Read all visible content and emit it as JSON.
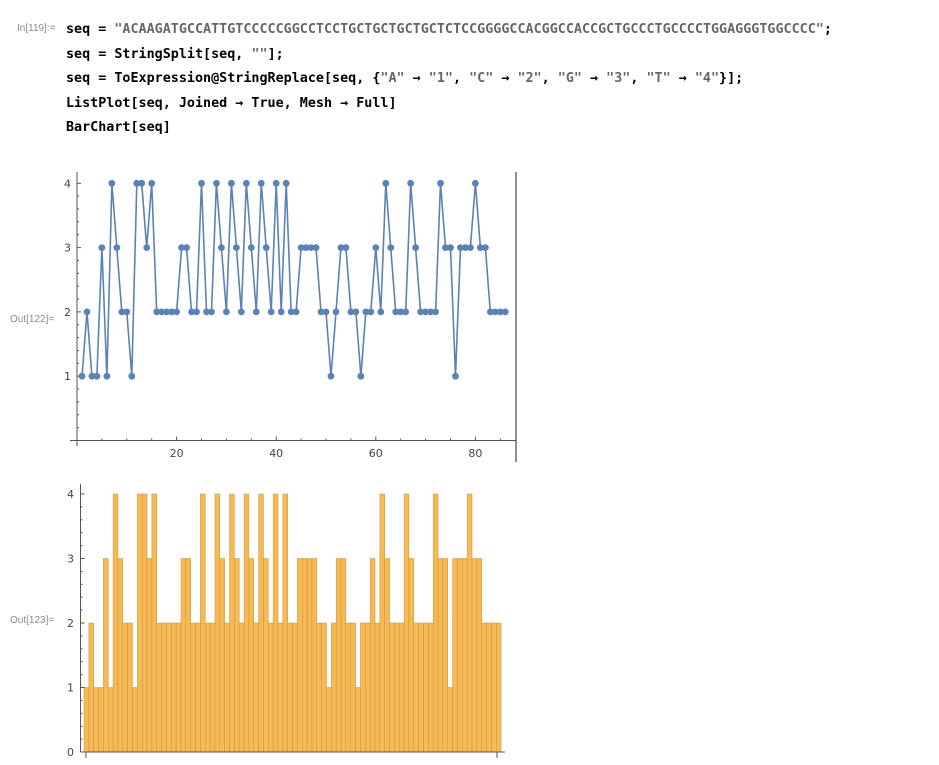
{
  "cells": {
    "input_label": "In[119]:=",
    "code_lines": [
      [
        "seq = ",
        {
          "s": "\"ACAAGATGCCATTGTCCCCCGGCCTCCTGCTGCTGCTGCTCTCCGGGGCCACGGCCACCGCTGCCCTGCCCCTGGAGGGTGGCCCC\""
        },
        ";"
      ],
      [
        "seq = StringSplit[seq, ",
        {
          "s": "\"\""
        },
        "];"
      ],
      [
        "seq = ToExpression@StringReplace[seq, {",
        {
          "s": "\"A\""
        },
        " → ",
        {
          "s": "\"1\""
        },
        ", ",
        {
          "s": "\"C\""
        },
        " → ",
        {
          "s": "\"2\""
        },
        ", ",
        {
          "s": "\"G\""
        },
        " → ",
        {
          "s": "\"3\""
        },
        ", ",
        {
          "s": "\"T\""
        },
        " → ",
        {
          "s": "\"4\""
        },
        "}];"
      ],
      [
        "ListPlot[seq, Joined → True, Mesh → Full]"
      ],
      [
        "BarChart[seq]"
      ]
    ],
    "output1_label": "Out[122]=",
    "output2_label": "Out[123]="
  },
  "colors": {
    "line": "#5e81b5",
    "bar_fill": "#f6b955",
    "bar_edge": "#c79435",
    "axis": "#555555"
  },
  "chart_data": [
    {
      "type": "line",
      "x_ticks": [
        20,
        40,
        60,
        80
      ],
      "y_ticks": [
        1,
        2,
        3,
        4
      ],
      "xlim": [
        0,
        88
      ],
      "ylim": [
        0,
        4.1
      ],
      "values": [
        1,
        2,
        1,
        1,
        3,
        1,
        4,
        3,
        2,
        2,
        1,
        4,
        4,
        3,
        4,
        2,
        2,
        2,
        2,
        2,
        3,
        3,
        2,
        2,
        4,
        2,
        2,
        4,
        3,
        2,
        4,
        3,
        2,
        4,
        3,
        2,
        4,
        3,
        2,
        4,
        2,
        4,
        2,
        2,
        3,
        3,
        3,
        3,
        2,
        2,
        1,
        2,
        3,
        3,
        2,
        2,
        1,
        2,
        2,
        3,
        2,
        4,
        3,
        2,
        2,
        2,
        4,
        3,
        2,
        2,
        2,
        2,
        4,
        3,
        3,
        1,
        3,
        3,
        3,
        4,
        3,
        3,
        2,
        2,
        2,
        2
      ],
      "grid": false
    },
    {
      "type": "bar",
      "y_ticks": [
        0,
        1,
        2,
        3,
        4
      ],
      "ylim": [
        0,
        4.1
      ],
      "values": [
        1,
        2,
        1,
        1,
        3,
        1,
        4,
        3,
        2,
        2,
        1,
        4,
        4,
        3,
        4,
        2,
        2,
        2,
        2,
        2,
        3,
        3,
        2,
        2,
        4,
        2,
        2,
        4,
        3,
        2,
        4,
        3,
        2,
        4,
        3,
        2,
        4,
        3,
        2,
        4,
        2,
        4,
        2,
        2,
        3,
        3,
        3,
        3,
        2,
        2,
        1,
        2,
        3,
        3,
        2,
        2,
        1,
        2,
        2,
        3,
        2,
        4,
        3,
        2,
        2,
        2,
        4,
        3,
        2,
        2,
        2,
        2,
        4,
        3,
        3,
        1,
        3,
        3,
        3,
        4,
        3,
        3,
        2,
        2,
        2,
        2
      ],
      "grid": false
    }
  ]
}
